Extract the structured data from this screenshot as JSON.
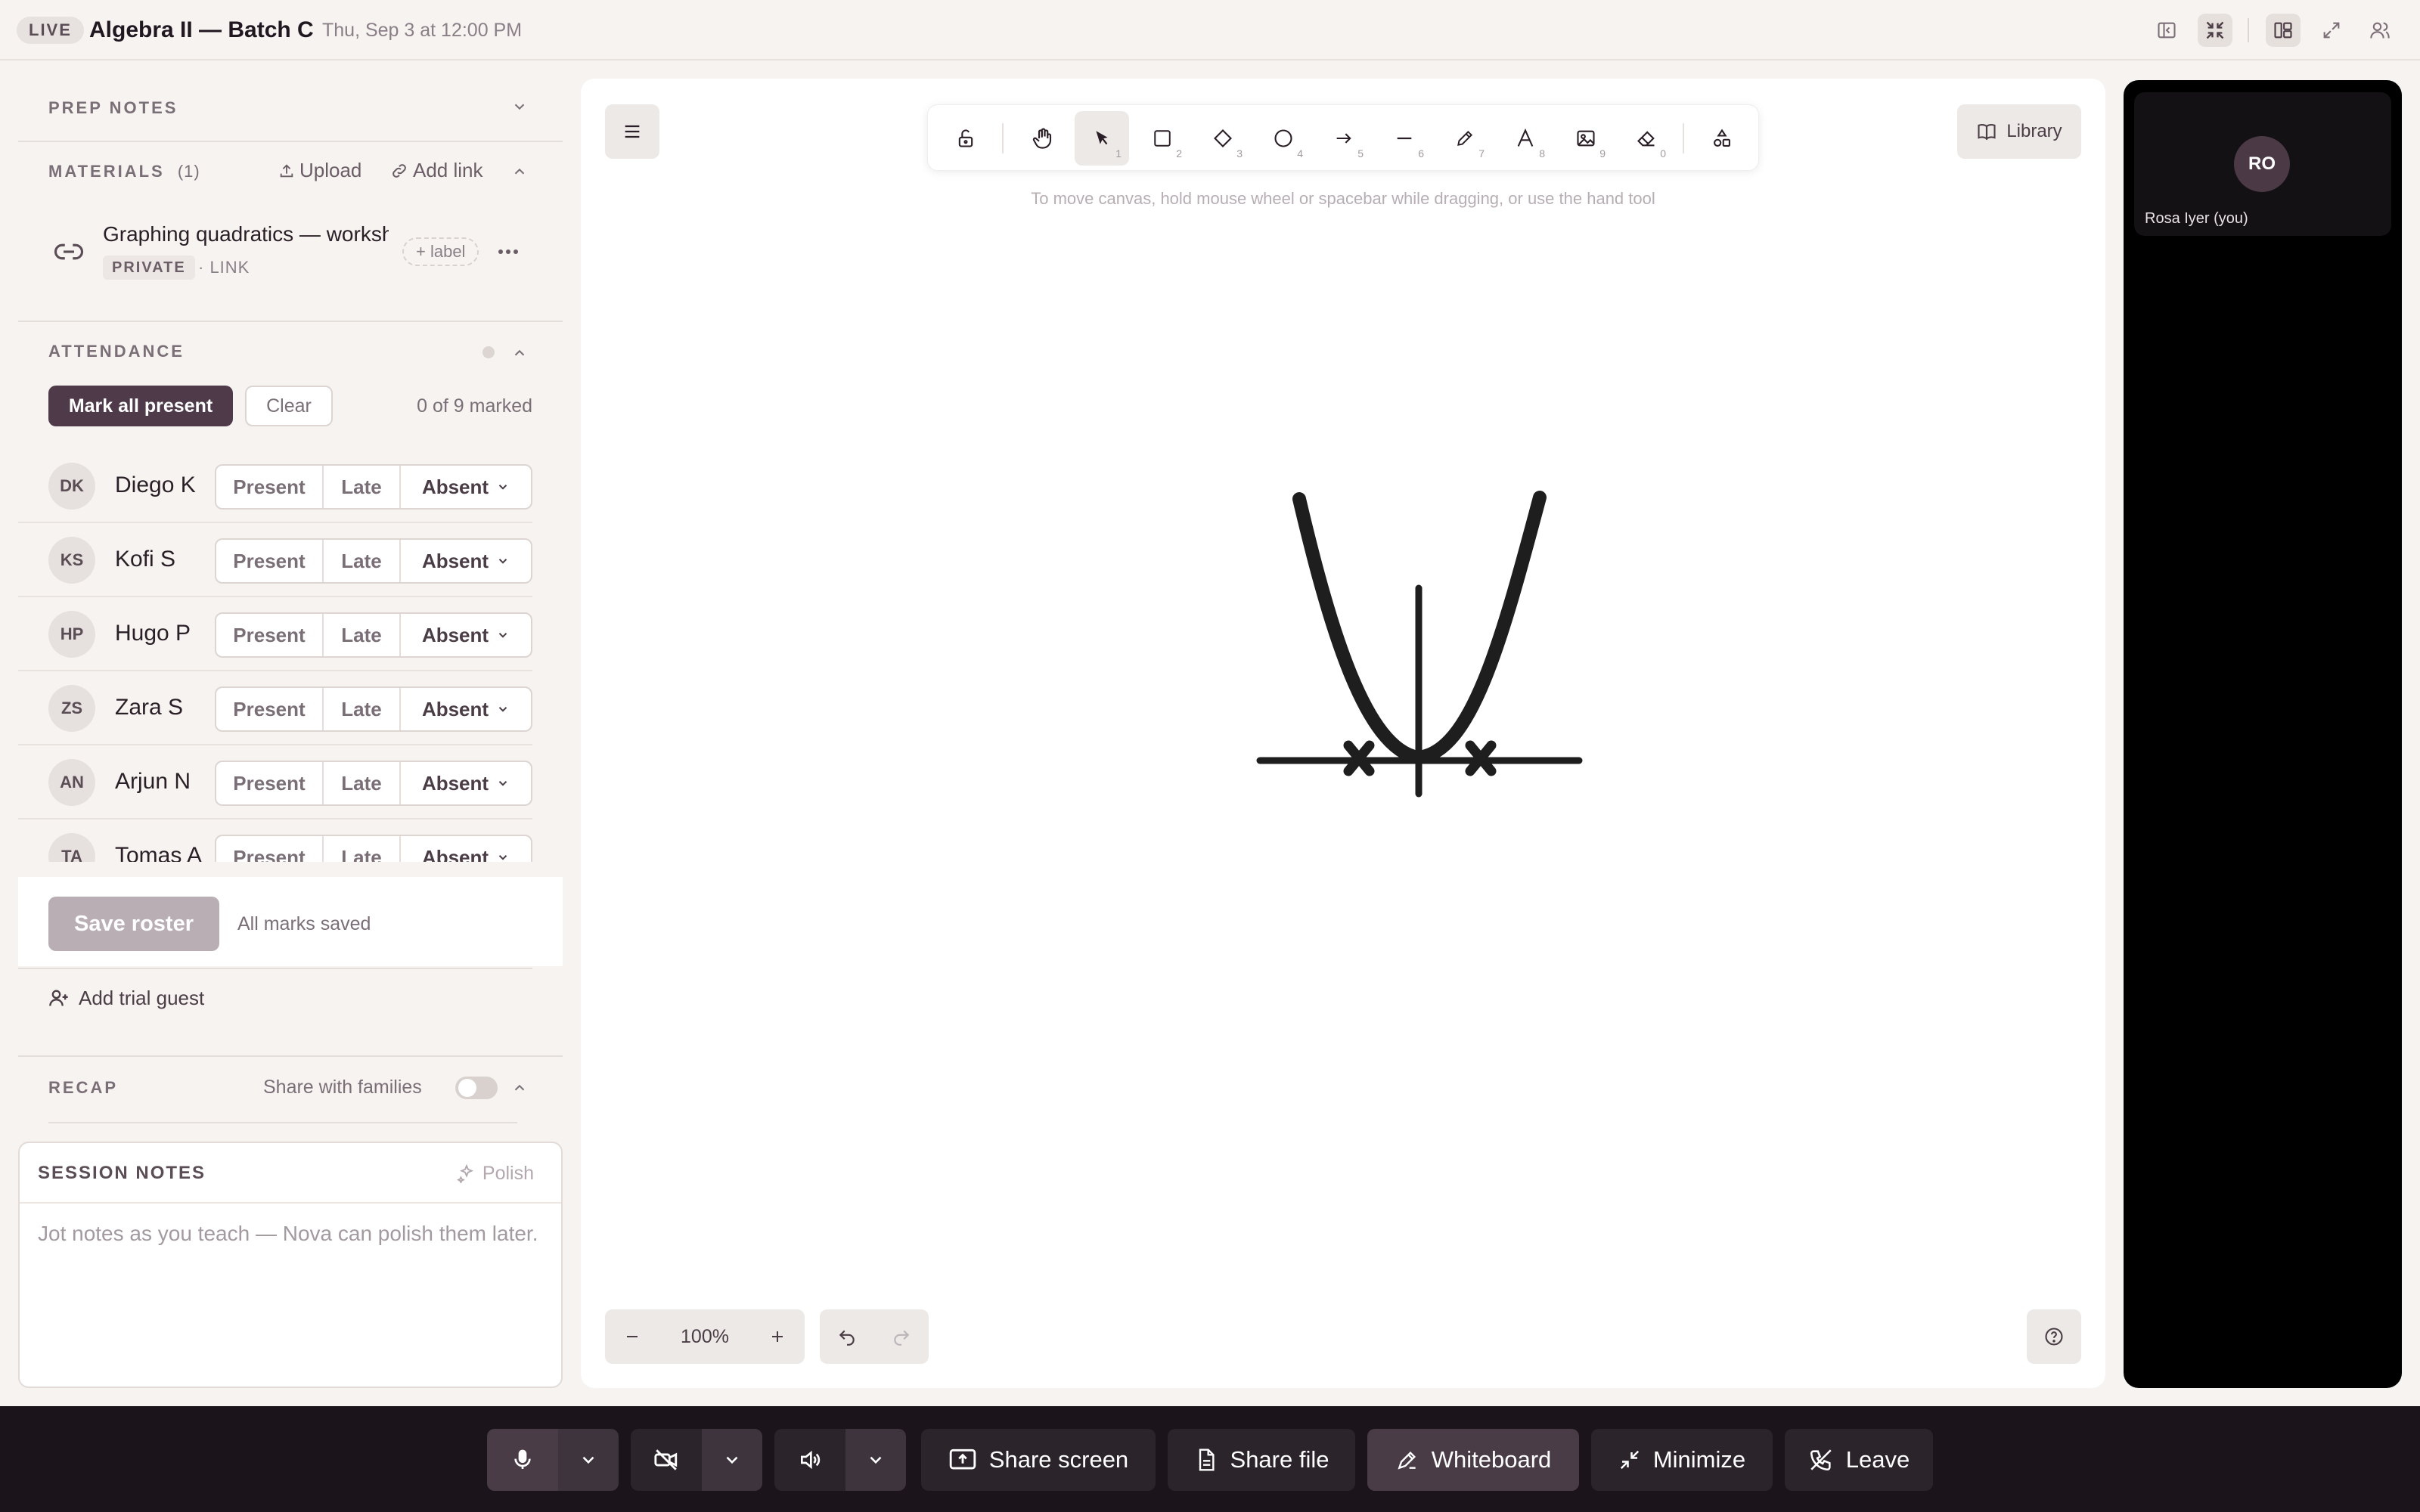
{
  "header": {
    "live_badge": "LIVE",
    "title": "Algebra II — Batch C",
    "datetime": "Thu, Sep 3 at 12:00 PM"
  },
  "prep_notes": {
    "title": "PREP NOTES"
  },
  "materials": {
    "title": "MATERIALS",
    "count": "(1)",
    "upload_label": "Upload",
    "add_link_label": "Add link",
    "items": [
      {
        "title": "Graphing quadratics — worksheet",
        "visibility": "PRIVATE",
        "type": "· LINK",
        "label_chip": "+ label"
      }
    ]
  },
  "attendance": {
    "title": "ATTENDANCE",
    "mark_all_label": "Mark all present",
    "clear_label": "Clear",
    "marked_count": "0 of 9 marked",
    "status_labels": {
      "present": "Present",
      "late": "Late",
      "absent": "Absent"
    },
    "students": [
      {
        "initials": "DK",
        "name": "Diego K"
      },
      {
        "initials": "KS",
        "name": "Kofi S"
      },
      {
        "initials": "HP",
        "name": "Hugo P"
      },
      {
        "initials": "ZS",
        "name": "Zara S"
      },
      {
        "initials": "AN",
        "name": "Arjun N"
      },
      {
        "initials": "TA",
        "name": "Tomas A"
      }
    ],
    "save_label": "Save roster",
    "save_status": "All marks saved",
    "trial_guest_label": "Add trial guest"
  },
  "recap": {
    "title": "RECAP",
    "share_label": "Share with families",
    "share_enabled": false
  },
  "session_notes": {
    "title": "SESSION NOTES",
    "polish_label": "Polish",
    "placeholder": "Jot notes as you teach — Nova can polish them later."
  },
  "whiteboard": {
    "toolbar": [
      {
        "icon": "lock-icon",
        "num": ""
      },
      {
        "icon": "hand-icon",
        "num": ""
      },
      {
        "icon": "pointer-icon",
        "num": "1"
      },
      {
        "icon": "rectangle-icon",
        "num": "2"
      },
      {
        "icon": "diamond-icon",
        "num": "3"
      },
      {
        "icon": "circle-icon",
        "num": "4"
      },
      {
        "icon": "arrow-icon",
        "num": "5"
      },
      {
        "icon": "line-icon",
        "num": "6"
      },
      {
        "icon": "pencil-icon",
        "num": "7"
      },
      {
        "icon": "text-icon",
        "num": "8"
      },
      {
        "icon": "image-icon",
        "num": "9"
      },
      {
        "icon": "eraser-icon",
        "num": "0"
      },
      {
        "icon": "shapes-icon",
        "num": ""
      }
    ],
    "library_label": "Library",
    "hint": "To move canvas, hold mouse wheel or spacebar while dragging, or use the hand tool",
    "zoom": "100%"
  },
  "video": {
    "initials": "RO",
    "name": "Rosa Iyer (you)"
  },
  "controls": {
    "share_screen": "Share screen",
    "share_file": "Share file",
    "whiteboard": "Whiteboard",
    "minimize": "Minimize",
    "leave": "Leave"
  },
  "colors": {
    "accent": "#4f3a49",
    "bottom_bar": "#1b141a",
    "canvas": "#ffffff",
    "stroke": "#1e1e1e"
  }
}
